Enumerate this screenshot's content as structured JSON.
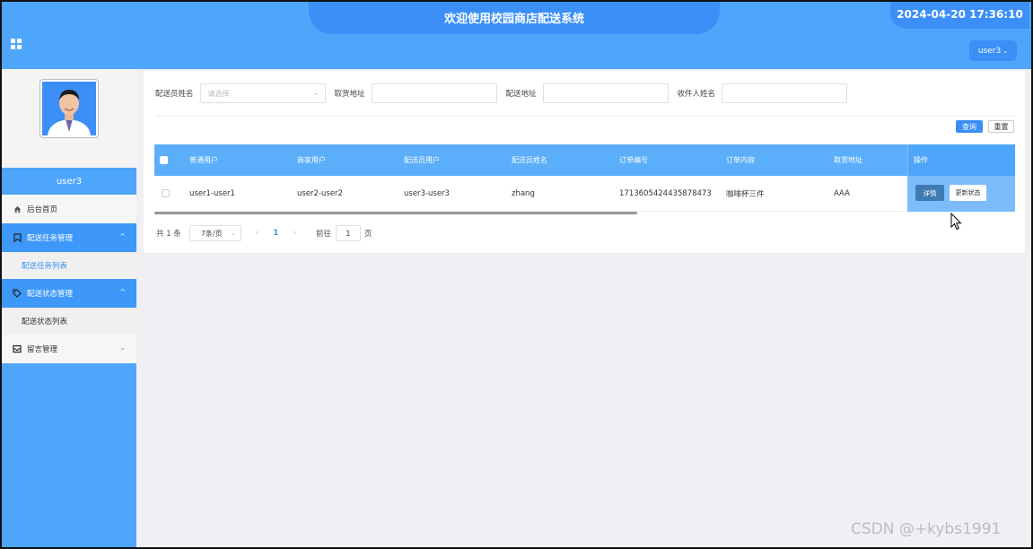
{
  "header": {
    "title": "欢迎使用校园商店配送系统",
    "datetime": "2024-04-20 17:36:10",
    "user_menu": "user3",
    "user_menu_chevron": "⌄"
  },
  "sidebar": {
    "username": "user3",
    "items": [
      {
        "label": "后台首页",
        "icon": "home-icon"
      },
      {
        "label": "配送任务管理",
        "icon": "bookmark-icon",
        "arrow": "^"
      },
      {
        "label": "配送任务列表"
      },
      {
        "label": "配送状态管理",
        "icon": "tag-icon",
        "arrow": "^"
      },
      {
        "label": "配送状态列表"
      },
      {
        "label": "留言管理",
        "icon": "message-icon",
        "arrow": "⌄"
      }
    ]
  },
  "filters": {
    "courier_name_label": "配送员姓名",
    "courier_name_placeholder": "请选择",
    "pickup_address_label": "取货地址",
    "delivery_address_label": "配送地址",
    "recipient_name_label": "收件人姓名",
    "dropdown_arrow": "⌄"
  },
  "buttons": {
    "query": "查询",
    "reset": "重置"
  },
  "table": {
    "columns": [
      "普通用户",
      "商家用户",
      "配送员用户",
      "配送员姓名",
      "订单编号",
      "订单内容",
      "取货地址",
      "操作"
    ],
    "rows": [
      {
        "regular_user": "user1-user1",
        "merchant_user": "user2-user2",
        "courier_user": "user3-user3",
        "courier_name": "zhang",
        "order_no": "1713605424435878473",
        "order_content": "咖啡杯三件",
        "pickup_address": "AAA",
        "detail_label": "详情",
        "update_label": "更新状态"
      }
    ]
  },
  "pagination": {
    "total": "共 1 条",
    "page_size": "7条/页",
    "dropdown_arrow": "⌄",
    "prev": "‹",
    "current_page": "1",
    "next": "›",
    "goto_label": "前往",
    "goto_value": "1",
    "page_suffix": "页"
  },
  "watermark": "CSDN @+kybs1991",
  "colors": {
    "primary": "#4ea6fb",
    "accent": "#3b8ff7",
    "detail_button": "#3f7bb3"
  }
}
